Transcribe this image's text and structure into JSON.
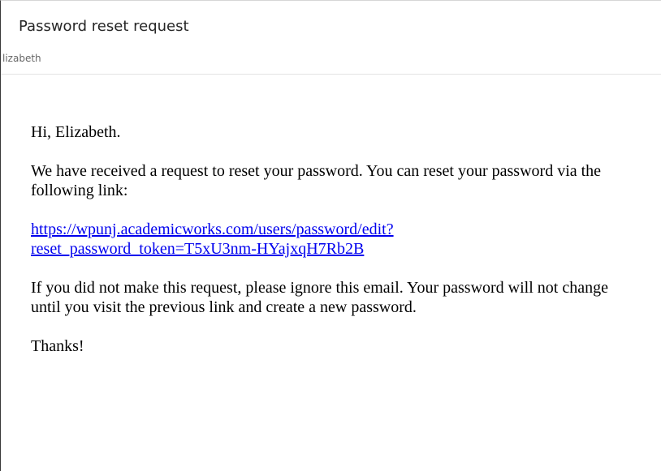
{
  "email": {
    "subject": "Password reset request",
    "sender_partial": "lizabeth"
  },
  "body": {
    "greeting": "Hi, Elizabeth.",
    "intro": "We have received a request to reset your password. You can reset your password via the following link:",
    "reset_link_line1": "https://wpunj.academicworks.com/users/password/edit?",
    "reset_link_line2": "reset_password_token=T5xU3nm-HYajxqH7Rb2B",
    "ignore_note": "If you did not make this request, please ignore this email. Your password will not change until you visit the previous link and create a new password.",
    "signoff": "Thanks!"
  },
  "colors": {
    "link": "#0000ee",
    "text": "#000000",
    "subject": "#262626",
    "sender": "#666666"
  }
}
